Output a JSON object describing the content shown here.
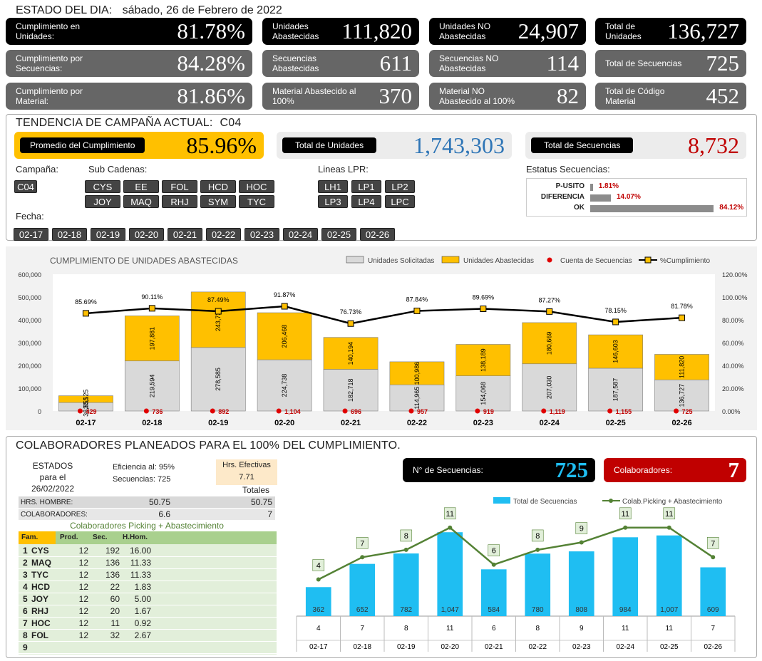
{
  "header": {
    "label": "ESTADO DEL DIA:",
    "date": "sábado, 26 de Febrero de 2022"
  },
  "kpis": [
    {
      "label": "Cumplimiento en Unidades:",
      "value": "81.78%",
      "style": "black"
    },
    {
      "label": "Unidades Abastecidas",
      "value": "111,820",
      "style": "black"
    },
    {
      "label": "Unidades NO Abastecidas",
      "value": "24,907",
      "style": "black"
    },
    {
      "label": "Total de Unidades",
      "value": "136,727",
      "style": "black"
    },
    {
      "label": "Cumplimiento por Secuencias:",
      "value": "84.28%",
      "style": "grey"
    },
    {
      "label": "Secuencias Abastecidas",
      "value": "611",
      "style": "grey"
    },
    {
      "label": "Secuencias NO Abastecidas",
      "value": "114",
      "style": "grey"
    },
    {
      "label": "Total de Secuencias",
      "value": "725",
      "style": "grey"
    },
    {
      "label": "Cumplimiento por Material:",
      "value": "81.86%",
      "style": "grey"
    },
    {
      "label": "Material Abastecido al 100%",
      "value": "370",
      "style": "grey"
    },
    {
      "label": "Material NO Abastecido al 100%",
      "value": "82",
      "style": "grey"
    },
    {
      "label": "Total de Código Material",
      "value": "452",
      "style": "grey"
    }
  ],
  "trend": {
    "title": "TENDENCIA DE CAMPAÑA ACTUAL:",
    "campaign": "C04",
    "avg_label": "Promedio  del Cumplimiento",
    "avg_value": "85.96%",
    "units_label": "Total de Unidades",
    "units_value": "1,743,303",
    "seq_label": "Total de Secuencias",
    "seq_value": "8,732"
  },
  "filters": {
    "campana_label": "Campaña:",
    "campana": [
      "C04"
    ],
    "subcad_label": "Sub Cadenas:",
    "subcad": [
      "CYS",
      "EE",
      "FOL",
      "HCD",
      "HOC",
      "JOY",
      "MAQ",
      "RHJ",
      "SYM",
      "TYC"
    ],
    "lineas_label": "Lineas LPR:",
    "lineas": [
      "LH1",
      "LP1",
      "LP2",
      "LP3",
      "LP4",
      "LPC"
    ],
    "estatus_label": "Estatus Secuencias:",
    "estatus": [
      {
        "name": "P-USITO",
        "pct": "1.81%",
        "v": 1.81
      },
      {
        "name": "DIFERENCIA",
        "pct": "14.07%",
        "v": 14.07
      },
      {
        "name": "OK",
        "pct": "84.12%",
        "v": 84.12
      }
    ],
    "fecha_label": "Fecha:",
    "fechas": [
      "02-17",
      "02-18",
      "02-19",
      "02-20",
      "02-21",
      "02-22",
      "02-23",
      "02-24",
      "02-25",
      "02-26"
    ]
  },
  "chart_data": [
    {
      "type": "bar",
      "title": "CUMPLIMIENTO DE UNIDADES ABASTECIDAS",
      "categories": [
        "02-17",
        "02-18",
        "02-19",
        "02-20",
        "02-21",
        "02-22",
        "02-23",
        "02-24",
        "02-25",
        "02-26"
      ],
      "series": [
        {
          "name": "Unidades Solicitadas",
          "values": [
            36855,
            219594,
            278585,
            224738,
            182718,
            114965,
            154068,
            207030,
            187587,
            136727
          ],
          "labels": [
            "36,855",
            "219,594",
            "278,585",
            "224,738",
            "182,718",
            "114,965",
            "154,068",
            "207,030",
            "187,587",
            "136,727"
          ]
        },
        {
          "name": "Unidades Abastecidas",
          "values": [
            30125,
            197881,
            243734,
            206468,
            140194,
            100986,
            138189,
            180669,
            146603,
            111820
          ],
          "labels": [
            "30,125",
            "197,881",
            "243,734",
            "206,468",
            "140,194",
            "100,986",
            "138,189",
            "180,669",
            "146,603",
            "111,820"
          ]
        },
        {
          "name": "Cuenta de Secuencias",
          "values": [
            429,
            736,
            892,
            1104,
            696,
            957,
            919,
            1119,
            1155,
            725
          ],
          "labels": [
            "429",
            "736",
            "892",
            "1,104",
            "696",
            "957",
            "919",
            "1,119",
            "1,155",
            "725"
          ]
        },
        {
          "name": "%Cumplimiento",
          "values": [
            85.69,
            90.11,
            87.49,
            91.87,
            76.73,
            87.84,
            89.69,
            87.27,
            78.15,
            81.78
          ],
          "labels": [
            "85.69%",
            "90.11%",
            "87.49%",
            "91.87%",
            "76.73%",
            "87.84%",
            "89.69%",
            "87.27%",
            "78.15%",
            "81.78%"
          ]
        }
      ],
      "ylim": [
        0,
        600000
      ],
      "y2lim": [
        0,
        120
      ],
      "yticks": [
        "0",
        "100,000",
        "200,000",
        "300,000",
        "400,000",
        "500,000",
        "600,000"
      ],
      "y2ticks": [
        "0.00%",
        "20.00%",
        "40.00%",
        "60.00%",
        "80.00%",
        "100.00%",
        "120.00%"
      ],
      "colors": {
        "solicitadas": "#d9d9d9",
        "abastecidas": "#ffc000",
        "secuencias": "#e00000",
        "line": "#000000"
      },
      "legend": "top-right"
    },
    {
      "type": "bar",
      "categories": [
        "02-17",
        "02-18",
        "02-19",
        "02-20",
        "02-21",
        "02-22",
        "02-23",
        "02-24",
        "02-25",
        "02-26"
      ],
      "series": [
        {
          "name": "Total de Secuencias",
          "values": [
            362,
            652,
            782,
            1047,
            584,
            780,
            808,
            984,
            1007,
            609
          ],
          "labels": [
            "362",
            "652",
            "782",
            "1,047",
            "584",
            "780",
            "808",
            "984",
            "1,007",
            "609"
          ]
        },
        {
          "name": "Colab.Picking + Abastecimiento",
          "values": [
            4,
            7,
            8,
            11,
            6,
            8,
            9,
            11,
            11,
            7
          ]
        }
      ],
      "colors": {
        "bars": "#1fbef2",
        "line": "#548235"
      },
      "legend": "top-right"
    }
  ],
  "collab": {
    "title": "COLABORADORES PLANEADOS PARA EL 100% DEL CUMPLIMIENTO.",
    "estados": "ESTADOS",
    "para": "para el",
    "date": "26/02/2022",
    "eficiencia": "Eficiencia al:",
    "eficiencia_val": "95%",
    "secuencias": "Secuencias:",
    "secuencias_val": "725",
    "hrs_label": "Hrs. Efectivas",
    "hrs_val": "7.71",
    "totales": "Totales",
    "hh_label": "HRS. HOMBRE:",
    "hh_val": "50.75",
    "hh_tot": "50.75",
    "col_label": "COLABORADORES:",
    "col_val": "6.6",
    "col_tot": "7",
    "table_title": "Colaboradores Picking + Abastecimiento",
    "headers": [
      "Fam.",
      "Prod.",
      "Sec.",
      "H.Hom."
    ],
    "rows": [
      [
        "1",
        "CYS",
        "12",
        "192",
        "16.00"
      ],
      [
        "2",
        "MAQ",
        "12",
        "136",
        "11.33"
      ],
      [
        "3",
        "TYC",
        "12",
        "136",
        "11.33"
      ],
      [
        "4",
        "HCD",
        "12",
        "22",
        "1.83"
      ],
      [
        "5",
        "JOY",
        "12",
        "60",
        "5.00"
      ],
      [
        "6",
        "RHJ",
        "12",
        "20",
        "1.67"
      ],
      [
        "7",
        "HOC",
        "12",
        "11",
        "0.92"
      ],
      [
        "8",
        "FOL",
        "12",
        "32",
        "2.67"
      ],
      [
        "9",
        "",
        "",
        "",
        ""
      ]
    ],
    "nsec_label": "N° de Secuencias:",
    "nsec_val": "725",
    "colab_label": "Colaboradores:",
    "colab_val": "7"
  }
}
